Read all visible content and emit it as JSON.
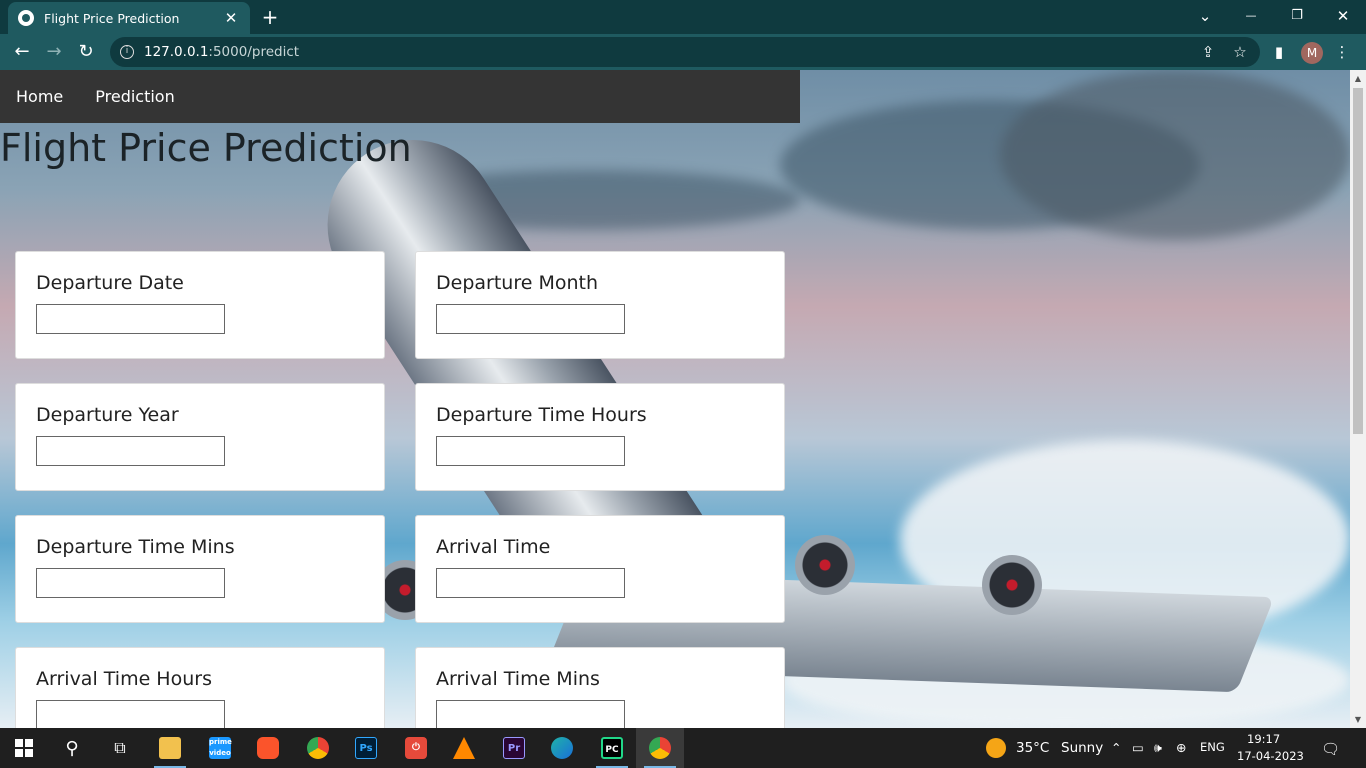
{
  "browser": {
    "tab_title": "Flight Price Prediction",
    "tab_close": "✕",
    "new_tab": "+",
    "url_host": "127.0.0.1",
    "url_path": ":5000/predict",
    "profile_initial": "M",
    "window_buttons": {
      "dropdown": "⌄",
      "minimize": "—",
      "restore": "❐",
      "close": "✕"
    },
    "nav_icons": {
      "back": "←",
      "forward": "→",
      "reload": "↻"
    }
  },
  "navbar": {
    "items": [
      {
        "label": "Home"
      },
      {
        "label": "Prediction"
      }
    ]
  },
  "page": {
    "title": "Flight Price Prediction",
    "fields": [
      {
        "label": "Departure Date",
        "value": ""
      },
      {
        "label": "Departure Month",
        "value": ""
      },
      {
        "label": "Departure Year",
        "value": ""
      },
      {
        "label": "Departure Time Hours",
        "value": ""
      },
      {
        "label": "Departure Time Mins",
        "value": ""
      },
      {
        "label": "Arrival Time",
        "value": ""
      },
      {
        "label": "Arrival Time Hours",
        "value": ""
      },
      {
        "label": "Arrival Time Mins",
        "value": ""
      }
    ]
  },
  "taskbar": {
    "apps": [
      {
        "name": "start",
        "icon": "windows-icon"
      },
      {
        "name": "search",
        "icon": "search-icon"
      },
      {
        "name": "task-view",
        "icon": "task-view-icon"
      },
      {
        "name": "file-explorer",
        "icon": "folder-icon",
        "color": "#f2c14e"
      },
      {
        "name": "prime-video",
        "icon": "prime-video-icon",
        "color": "#1a98ff"
      },
      {
        "name": "brave",
        "icon": "brave-icon",
        "color": "#fb542b"
      },
      {
        "name": "chrome",
        "icon": "chrome-icon",
        "color": "#4caf50"
      },
      {
        "name": "photoshop",
        "icon": "photoshop-icon",
        "color": "#31a8ff"
      },
      {
        "name": "app-red",
        "icon": "power-icon",
        "color": "#e64a3b"
      },
      {
        "name": "vlc",
        "icon": "vlc-icon",
        "color": "#ff8800"
      },
      {
        "name": "premiere",
        "icon": "premiere-icon",
        "color": "#9999ff"
      },
      {
        "name": "edge",
        "icon": "edge-icon",
        "color": "#1fb3a8"
      },
      {
        "name": "pycharm",
        "icon": "pycharm-icon",
        "color": "#21d789"
      },
      {
        "name": "chrome-profile",
        "icon": "chrome-icon",
        "color": "#4caf50",
        "active": true
      }
    ],
    "weather": {
      "temp": "35°C",
      "condition": "Sunny"
    },
    "lang": "ENG",
    "time": "19:17",
    "date": "17-04-2023"
  }
}
